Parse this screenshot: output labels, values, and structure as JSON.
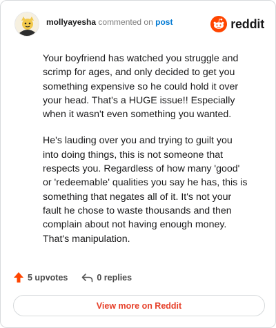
{
  "comment": {
    "username": "mollyayesha",
    "action_text": "commented on",
    "post_link_label": "post",
    "paragraphs": [
      "Your boyfriend has watched you struggle and scrimp for ages, and only decided to get you something expensive so he could hold it over your head. That's a HUGE issue!! Especially when it wasn't even something you wanted.",
      "He's lauding over you and trying to guilt you into doing things, this is not someone that respects you. Regardless of how many 'good' or 'redeemable' qualities you say he has, this is something that negates all of it. It's not your fault he chose to waste thousands and then complain about not having enough money. That's manipulation."
    ]
  },
  "brand": {
    "name": "reddit",
    "color": "#ff4500"
  },
  "stats": {
    "upvotes_label": "5 upvotes",
    "replies_label": "0 replies",
    "upvote_color": "#ff4500"
  },
  "cta": {
    "label": "View more on Reddit",
    "color": "#e6402a"
  }
}
